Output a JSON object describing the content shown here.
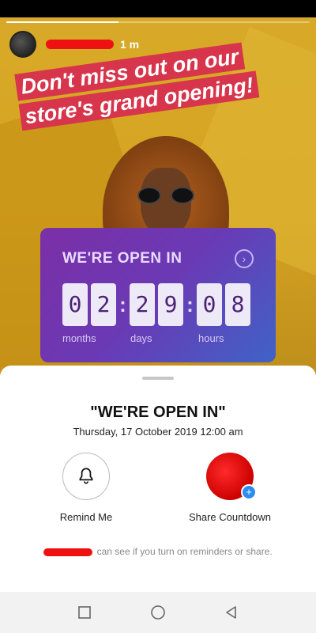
{
  "story": {
    "progress": 0.37,
    "time_ago": "1 m",
    "headline": "Don't miss out on our store's grand opening!",
    "countdown": {
      "title": "WE'RE OPEN IN",
      "digits": [
        "0",
        "2",
        "2",
        "9",
        "0",
        "8"
      ],
      "units": [
        "months",
        "days",
        "hours"
      ]
    }
  },
  "sheet": {
    "title": "\"WE'RE OPEN IN\"",
    "date": "Thursday, 17 October 2019 12:00 am",
    "actions": {
      "remind_label": "Remind Me",
      "share_label": "Share Countdown"
    },
    "footer": "can see if you turn on reminders or share."
  },
  "icons": {
    "bell": "bell-icon",
    "plus": "plus-icon",
    "arrow": "chevron-right-icon",
    "nav": [
      "square-icon",
      "circle-icon",
      "triangle-back-icon"
    ]
  },
  "colors": {
    "story_bg": "#d6a322",
    "headline_bg": "#d7354b",
    "card_gradient_start": "#7b2fa6",
    "card_gradient_end": "#3f63c7",
    "accent_blue": "#2d8cf0"
  }
}
